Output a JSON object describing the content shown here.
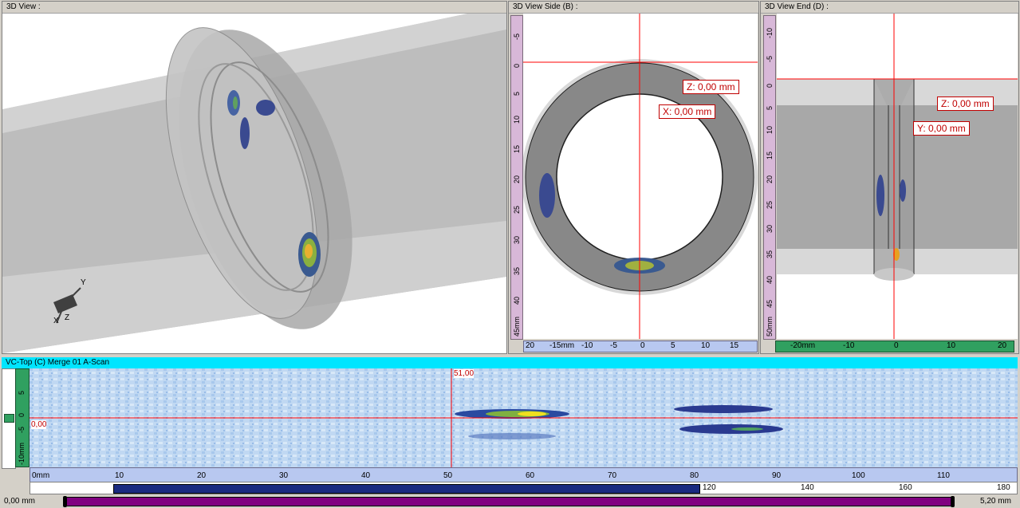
{
  "views": {
    "view3d": {
      "title": "3D View  :"
    },
    "side": {
      "title": "3D View Side (B)  :",
      "coord_z": "Z: 0,00 mm",
      "coord_x": "X: 0,00 mm",
      "vruler": [
        "-5",
        "0",
        "5",
        "10",
        "15",
        "20",
        "25",
        "30",
        "35",
        "40",
        "45mm"
      ],
      "hruler": [
        "20",
        "-15mm",
        "-10",
        "-5",
        "0",
        "5",
        "10",
        "15"
      ]
    },
    "end": {
      "title": "3D View End (D)  :",
      "coord_z": "Z: 0,00 mm",
      "coord_y": "Y: 0,00 mm",
      "vruler": [
        "-10",
        "-5",
        "0",
        "5",
        "10",
        "15",
        "20",
        "25",
        "30",
        "35",
        "40",
        "45",
        "50mm"
      ],
      "hruler": [
        "-20mm",
        "-10",
        "0",
        "10",
        "20"
      ]
    }
  },
  "cscan": {
    "title": "VC-Top (C) Merge 01 A-Scan",
    "cursor_x_label": "51,00",
    "cursor_y_label": "0,00",
    "vruler": [
      "-10mm",
      "-5",
      "0",
      "5"
    ],
    "hruler": [
      "0mm",
      "10",
      "20",
      "30",
      "40",
      "50",
      "60",
      "70",
      "80",
      "90",
      "100",
      "110"
    ],
    "overview_ticks": [
      "120",
      "140",
      "160",
      "180"
    ]
  },
  "status": {
    "left_value": "0,00 mm",
    "right_value": "5,20 mm"
  },
  "axis_triad": {
    "y": "Y",
    "x": "X",
    "z": "Z"
  },
  "colors": {
    "cursor": "#ff0000",
    "scan_bg": "#b8d4f0",
    "ruler_green": "#30a060",
    "scroll": "#800080"
  }
}
